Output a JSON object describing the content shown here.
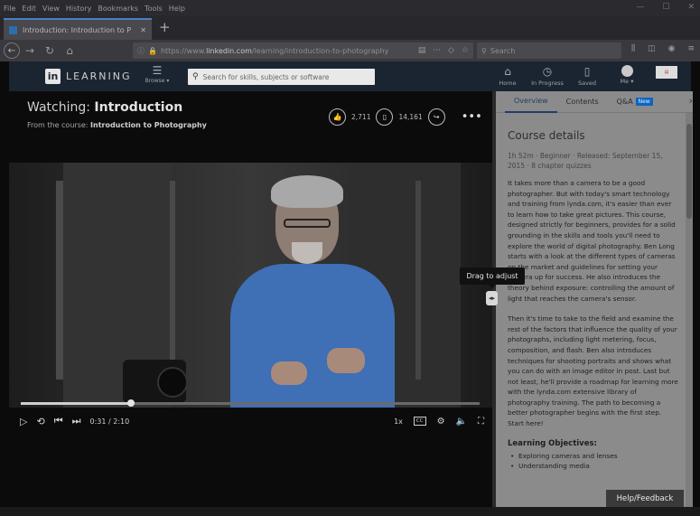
{
  "browser": {
    "menu": [
      "File",
      "Edit",
      "View",
      "History",
      "Bookmarks",
      "Tools",
      "Help"
    ],
    "tab_title": "Introduction: Introduction to P",
    "url_prefix": "https://www.",
    "url_domain": "linkedin.com",
    "url_path": "/learning/introduction-to-photography",
    "search_placeholder": "Search"
  },
  "header": {
    "logo_text": "LEARNING",
    "browse_label": "Browse ▾",
    "search_placeholder": "Search for skills, subjects or software",
    "nav": [
      {
        "label": "Home",
        "icon": "home-icon"
      },
      {
        "label": "In Progress",
        "icon": "clock-icon"
      },
      {
        "label": "Saved",
        "icon": "bookmark-icon"
      },
      {
        "label": "Me ▾",
        "icon": "avatar"
      }
    ]
  },
  "video": {
    "watching_prefix": "Watching: ",
    "title": "Introduction",
    "from_prefix": "From the course: ",
    "course": "Introduction to Photography",
    "likes": "2,711",
    "saves": "14,161",
    "time": "0:31 / 2:10",
    "progress": 0.24,
    "speed": "1x"
  },
  "tooltip": "Drag to adjust",
  "side": {
    "tabs": [
      "Overview",
      "Contents",
      "Q&A"
    ],
    "new_badge": "New",
    "heading": "Course details",
    "meta": "1h 52m · Beginner · Released: September 15, 2015 · 8 chapter quizzes",
    "para1": "It takes more than a camera to be a good photographer. But with today's smart technology and training from lynda.com, it's easier than ever to learn how to take great pictures. This course, designed strictly for beginners, provides for a solid grounding in the skills and tools you'll need to explore the world of digital photography. Ben Long starts with a look at the different types of cameras on the market and guidelines for setting your camera up for success. He also introduces the theory behind exposure: controlling the amount of light that reaches the camera's sensor.",
    "para2": "Then it's time to take to the field and examine the rest of the factors that influence the quality of your photographs, including light metering, focus, composition, and flash. Ben also introduces techniques for shooting portraits and shows what you can do with an image editor in post. Last but not least, he'll provide a roadmap for learning more with the lynda.com extensive library of photography training. The path to becoming a better photographer begins with the first step. Start here!",
    "objectives_heading": "Learning Objectives:",
    "objectives": [
      "Exploring cameras and lenses",
      "Understanding media"
    ]
  },
  "feedback": "Help/Feedback"
}
